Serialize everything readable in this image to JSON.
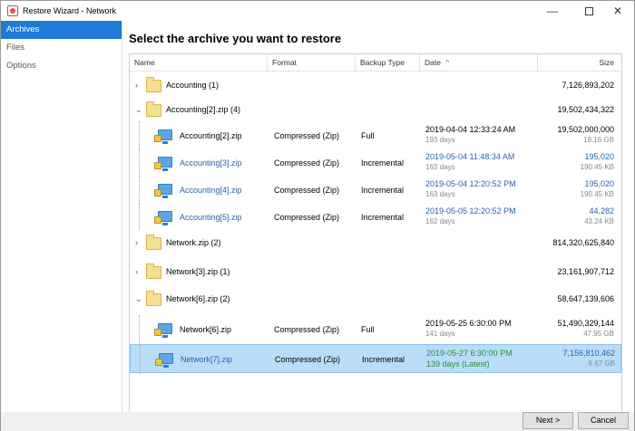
{
  "window": {
    "title": "Restore Wizard - Network"
  },
  "sidebar": {
    "items": [
      {
        "label": "Archives"
      },
      {
        "label": "Files"
      },
      {
        "label": "Options"
      }
    ]
  },
  "main": {
    "heading": "Select the archive you want to restore",
    "columns": [
      "Name",
      "Format",
      "Backup Type",
      "Date",
      "Size"
    ],
    "sort_indicator": "^",
    "rows": [
      {
        "type": "group",
        "expanded": false,
        "name": "Accounting (1)",
        "size": "7,126,893,202"
      },
      {
        "type": "group",
        "expanded": true,
        "name": "Accounting[2].zip (4)",
        "size": "19,502,434,322"
      },
      {
        "type": "file",
        "name": "Accounting[2].zip",
        "format": "Compressed (Zip)",
        "backup": "Full",
        "date": "2019-04-04 12:33:24 AM",
        "age": "193 days",
        "size": "19,502,000,000",
        "size2": "18.16 GB",
        "tone": "normal"
      },
      {
        "type": "file",
        "name": "Accounting[3].zip",
        "format": "Compressed (Zip)",
        "backup": "Incremental",
        "date": "2019-05-04 11:48:34 AM",
        "age": "163 days",
        "size": "195,020",
        "size2": "190.45 KB",
        "tone": "blue"
      },
      {
        "type": "file",
        "name": "Accounting[4].zip",
        "format": "Compressed (Zip)",
        "backup": "Incremental",
        "date": "2019-05-04 12:20:52 PM",
        "age": "163 days",
        "size": "195,020",
        "size2": "190.45 KB",
        "tone": "blue"
      },
      {
        "type": "file",
        "name": "Accounting[5].zip",
        "format": "Compressed (Zip)",
        "backup": "Incremental",
        "date": "2019-05-05 12:20:52 PM",
        "age": "162 days",
        "size": "44,282",
        "size2": "43.24 KB",
        "tone": "blue"
      },
      {
        "type": "group",
        "expanded": false,
        "name": "Network.zip (2)",
        "size": "814,320,625,840"
      },
      {
        "type": "group",
        "expanded": false,
        "name": "Network[3].zip (1)",
        "size": "23,161,907,712"
      },
      {
        "type": "group",
        "expanded": true,
        "name": "Network[6].zip (2)",
        "size": "58,647,139,606"
      },
      {
        "type": "file",
        "name": "Network[6].zip",
        "format": "Compressed (Zip)",
        "backup": "Full",
        "date": "2019-05-25 6:30:00 PM",
        "age": "141 days",
        "size": "51,490,329,144",
        "size2": "47.95 GB",
        "tone": "normal"
      },
      {
        "type": "file",
        "name": "Network[7].zip",
        "format": "Compressed (Zip)",
        "backup": "Incremental",
        "date": "2019-05-27 6:30:00 PM",
        "age": "139 days (Latest)",
        "size": "7,156,810,462",
        "size2": "6.67 GB",
        "tone": "selected"
      }
    ]
  },
  "footer": {
    "next_label": "Next >",
    "cancel_label": "Cancel"
  },
  "colors": {
    "accent": "#1e7bd6",
    "selection": "#b9ddf9",
    "link_blue": "#2d62a8",
    "latest_green": "#2f8f2f"
  },
  "icons": {
    "app": "restore-app-icon",
    "group": "folder-icon",
    "file": "computer-archive-icon"
  }
}
